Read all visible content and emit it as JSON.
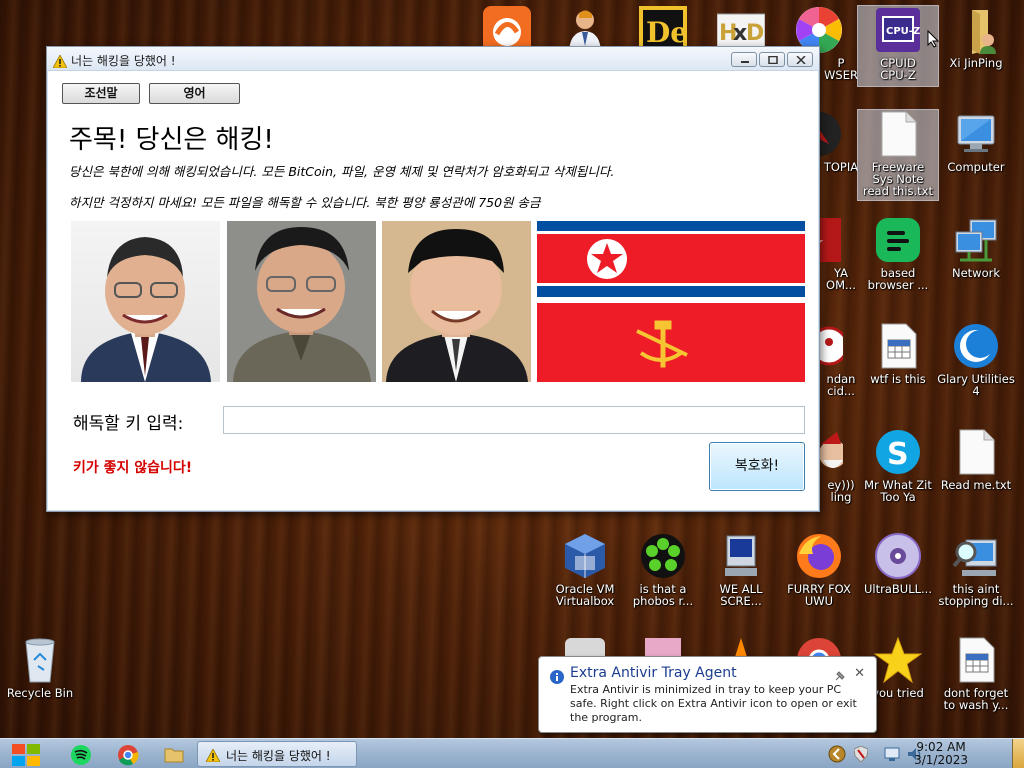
{
  "desktop": {
    "icons": [
      {
        "id": "avast",
        "label": ""
      },
      {
        "id": "person",
        "label": ""
      },
      {
        "id": "de",
        "label": ""
      },
      {
        "id": "hxd",
        "label": ""
      },
      {
        "id": "browser",
        "label": "P\nWSER"
      },
      {
        "id": "cpuz",
        "label": "CPUID\nCPU-Z"
      },
      {
        "id": "xijinping",
        "label": "Xi JinPing"
      },
      {
        "id": "topia",
        "label": "TOPIA"
      },
      {
        "id": "freeware",
        "label": "Freeware\nSys Note\nread this.txt"
      },
      {
        "id": "computer",
        "label": "Computer"
      },
      {
        "id": "ya",
        "label": "YA\nOM..."
      },
      {
        "id": "based",
        "label": "based\nbrowser ..."
      },
      {
        "id": "network",
        "label": "Network"
      },
      {
        "id": "ndan",
        "label": "ndan\ncid..."
      },
      {
        "id": "wtf",
        "label": "wtf is this"
      },
      {
        "id": "glary",
        "label": "Glary Utilities\n4"
      },
      {
        "id": "yling",
        "label": "ey)))\nling"
      },
      {
        "id": "skype",
        "label": "Mr What Zit\nToo Ya"
      },
      {
        "id": "readme",
        "label": "Read me.txt"
      },
      {
        "id": "vbox",
        "label": "Oracle VM\nVirtualbox"
      },
      {
        "id": "icq",
        "label": "is that a\nphobos r..."
      },
      {
        "id": "weall",
        "label": "WE ALL\nSCRE..."
      },
      {
        "id": "firefox",
        "label": "FURRY FOX\nUWU"
      },
      {
        "id": "ultrabull",
        "label": "UltraBULL..."
      },
      {
        "id": "stopping",
        "label": "this aint\nstopping di..."
      },
      {
        "id": "recycle",
        "label": "Recycle Bin"
      },
      {
        "id": "youtried",
        "label": "you tried"
      },
      {
        "id": "wash",
        "label": "dont forget\nto wash y..."
      }
    ]
  },
  "window": {
    "title": "너는 해킹을 당했어 !",
    "buttons": {
      "korean": "조선말",
      "english": "영어"
    },
    "heading": "주목! 당신은 해킹!",
    "message1": "당신은 북한에 의해 해킹되었습니다. 모든 BitCoin, 파일, 운영 체제 및 연락처가 암호화되고 삭제됩니다.",
    "message2": "하지만 걱정하지 마세요! 모든 파일을 해독할 수 있습니다. 북한 평양 룡성관에 750원 송금",
    "key_label": "해독할 키 입력:",
    "key_value": "",
    "error": "키가 좋지 않습니다!",
    "decrypt_button": "복호화!"
  },
  "notification": {
    "title": "Extra Antivir Tray Agent",
    "body": "Extra Antivir is minimized in tray to keep your PC safe. Right click on Extra Antivir icon to open or exit the program."
  },
  "taskbar": {
    "task_title": "너는 해킹을 당했어 !",
    "time": "9:02 AM",
    "date": "3/1/2023"
  },
  "colors": {
    "error": "#d40000",
    "flag_red": "#ed1c27",
    "flag_blue": "#024fa2"
  }
}
